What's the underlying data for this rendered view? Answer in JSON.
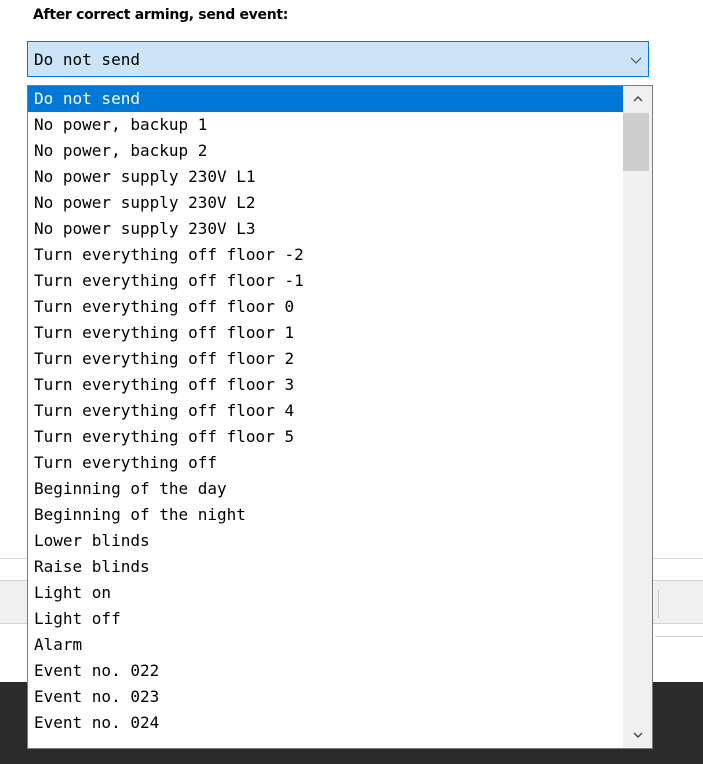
{
  "heading": "After correct arming, send event:",
  "select": {
    "value": "Do not send",
    "arrow_icon": "chevron-down-icon"
  },
  "dropdown": {
    "selected_index": 0,
    "options": [
      "Do not send",
      "No power, backup 1",
      "No power, backup 2",
      "No power supply 230V L1",
      "No power supply 230V L2",
      "No power supply 230V L3",
      "Turn everything off floor -2",
      "Turn everything off floor -1",
      "Turn everything off floor 0",
      "Turn everything off floor 1",
      "Turn everything off floor 2",
      "Turn everything off floor 3",
      "Turn everything off floor 4",
      "Turn everything off floor 5",
      "Turn everything off",
      "Beginning of the day",
      "Beginning of the night",
      "Lower blinds",
      "Raise blinds",
      "Light on",
      "Light off",
      "Alarm",
      "Event no. 022",
      "Event no. 023",
      "Event no. 024"
    ],
    "scrollbar": {
      "up_icon": "chevron-up-icon",
      "down_icon": "chevron-down-icon"
    }
  },
  "colors": {
    "accent": "#0078d7",
    "select_bg": "#cce4f7",
    "scrollbar_track": "#f0f0f0",
    "scrollbar_thumb": "#cdcdcd"
  }
}
